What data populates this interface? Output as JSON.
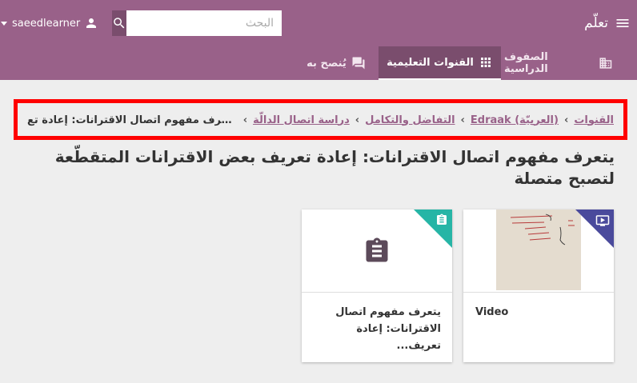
{
  "header": {
    "brand": "تعلّم",
    "username": "saeedlearner",
    "search_placeholder": "البحث"
  },
  "tabs": {
    "classes": "الصفوف الدراسية",
    "channels": "القنوات التعليمية",
    "recommended": "يُنصح به"
  },
  "breadcrumb": {
    "items": [
      "القنوات",
      "Edraak (العربيّة)",
      "التفاضل والتكامل",
      "دراسة اتصال الدالّة"
    ],
    "current": "يتعرف مفهوم اتصال الاقترانات: إعادة تع..."
  },
  "page_title": "يتعرف مفهوم اتصال الاقترانات: إعادة تعريف بعض الاقترانات المتقطّعة لتصبح متصلة",
  "cards": {
    "video": {
      "title": "Video",
      "kind": "video-icon",
      "accent": "#4a4a9c"
    },
    "exercise": {
      "title": "يتعرف مفهوم اتصال الاقترانات: إعادة تعريف...",
      "kind": "clipboard-icon",
      "accent": "#26b5a6"
    }
  },
  "colors": {
    "brand": "#996189",
    "brand_dark": "#7a4d6d",
    "highlight": "#ff0000"
  }
}
